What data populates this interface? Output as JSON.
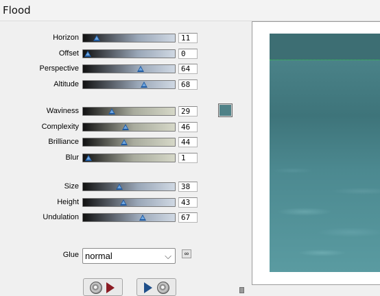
{
  "window": {
    "title": "Flood"
  },
  "groups": [
    {
      "sliders": [
        {
          "key": "horizon",
          "label": "Horizon",
          "value": "11",
          "fraction": 0.11,
          "gradient": "linear-gradient(to right,#111,#9aa7b8 60%,#cfd8e3)"
        },
        {
          "key": "offset",
          "label": "Offset",
          "value": "0",
          "fraction": 0.0,
          "gradient": "linear-gradient(to right,#111,#9aa7b8 60%,#cfd8e3)"
        },
        {
          "key": "perspective",
          "label": "Perspective",
          "value": "64",
          "fraction": 0.64,
          "gradient": "linear-gradient(to right,#111,#9aa7b8 60%,#cfd8e3)"
        },
        {
          "key": "altitude",
          "label": "Altitude",
          "value": "68",
          "fraction": 0.68,
          "gradient": "linear-gradient(to right,#111,#9aa7b8 60%,#cfd8e3)"
        }
      ]
    },
    {
      "sliders": [
        {
          "key": "waviness",
          "label": "Waviness",
          "value": "29",
          "fraction": 0.29,
          "gradient": "linear-gradient(to right,#111,#a8ab9d 55%,#d6d8c8)"
        },
        {
          "key": "complexity",
          "label": "Complexity",
          "value": "46",
          "fraction": 0.46,
          "gradient": "linear-gradient(to right,#111,#a8ab9d 55%,#d6d8c8)"
        },
        {
          "key": "brilliance",
          "label": "Brilliance",
          "value": "44",
          "fraction": 0.44,
          "gradient": "linear-gradient(to right,#111,#a8ab9d 55%,#d6d8c8)"
        },
        {
          "key": "blur",
          "label": "Blur",
          "value": "1",
          "fraction": 0.01,
          "gradient": "linear-gradient(to right,#111,#a8ab9d 55%,#d6d8c8)"
        }
      ]
    },
    {
      "sliders": [
        {
          "key": "size",
          "label": "Size",
          "value": "38",
          "fraction": 0.38,
          "gradient": "linear-gradient(to right,#111,#9aa7b8 60%,#cfd8e3)"
        },
        {
          "key": "height",
          "label": "Height",
          "value": "43",
          "fraction": 0.43,
          "gradient": "linear-gradient(to right,#111,#9aa7b8 60%,#cfd8e3)"
        },
        {
          "key": "undulation",
          "label": "Undulation",
          "value": "67",
          "fraction": 0.67,
          "gradient": "linear-gradient(to right,#111,#9aa7b8 60%,#cfd8e3)"
        }
      ]
    }
  ],
  "color_swatch": {
    "color": "#4f8187"
  },
  "glue": {
    "label": "Glue",
    "selected": "normal",
    "arrow": "⌵"
  },
  "buttons": {
    "reset_icon": "disc-arrow-left-icon",
    "apply_icon": "arrow-disc-right-icon"
  },
  "preview": {
    "horizon_color": "#36d14b"
  }
}
